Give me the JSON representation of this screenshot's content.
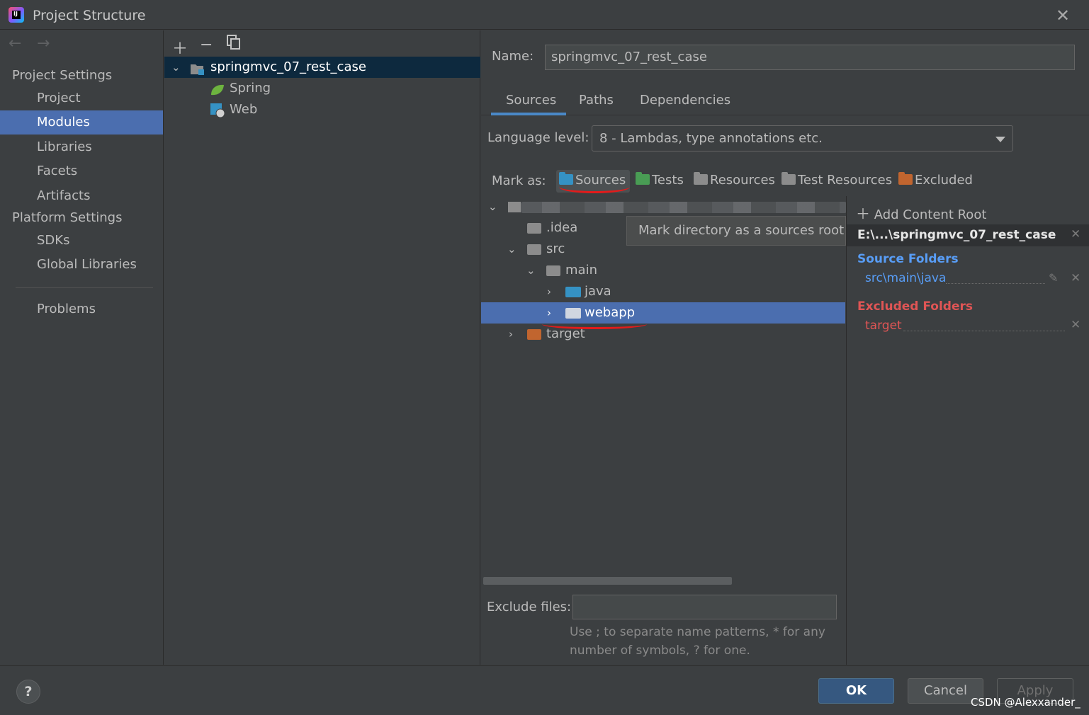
{
  "window": {
    "title": "Project Structure"
  },
  "sidebar": {
    "sections": [
      {
        "label": "Project Settings",
        "items": [
          "Project",
          "Modules",
          "Libraries",
          "Facets",
          "Artifacts"
        ]
      },
      {
        "label": "Platform Settings",
        "items": [
          "SDKs",
          "Global Libraries"
        ]
      }
    ],
    "problems": "Problems",
    "selected": "Modules"
  },
  "modules": {
    "root": "springmvc_07_rest_case",
    "facets": [
      "Spring",
      "Web"
    ]
  },
  "editor": {
    "name_label": "Name:",
    "name_value": "springmvc_07_rest_case",
    "tabs": [
      "Sources",
      "Paths",
      "Dependencies"
    ],
    "active_tab": "Sources",
    "language_label": "Language level:",
    "language_value": "8 - Lambdas, type annotations etc.",
    "mark_as_label": "Mark as:",
    "mark_buttons": [
      {
        "label": "Sources",
        "color": "#3592c4"
      },
      {
        "label": "Tests",
        "color": "#499c54"
      },
      {
        "label": "Resources",
        "color": "#8c8c8c"
      },
      {
        "label": "Test Resources",
        "color": "#8c8c8c"
      },
      {
        "label": "Excluded",
        "color": "#c1652f"
      }
    ],
    "tooltip": "Mark directory as a sources root",
    "tree": [
      ".idea",
      "src",
      "main",
      "java",
      "webapp",
      "target"
    ],
    "exclude_label": "Exclude files:",
    "exclude_value": "",
    "exclude_hint_1": "Use ; to separate name patterns, * for any",
    "exclude_hint_2": "number of symbols, ? for one."
  },
  "roots": {
    "add_label": "Add Content Root",
    "root_path": "E:\\...\\springmvc_07_rest_case",
    "source_heading": "Source Folders",
    "source_item": "src\\main\\java",
    "excluded_heading": "Excluded Folders",
    "excluded_item": "target",
    "source_color": "#589df6",
    "excluded_color": "#e05555"
  },
  "footer": {
    "ok": "OK",
    "cancel": "Cancel",
    "apply": "Apply",
    "watermark": "CSDN @Alexxander_"
  }
}
